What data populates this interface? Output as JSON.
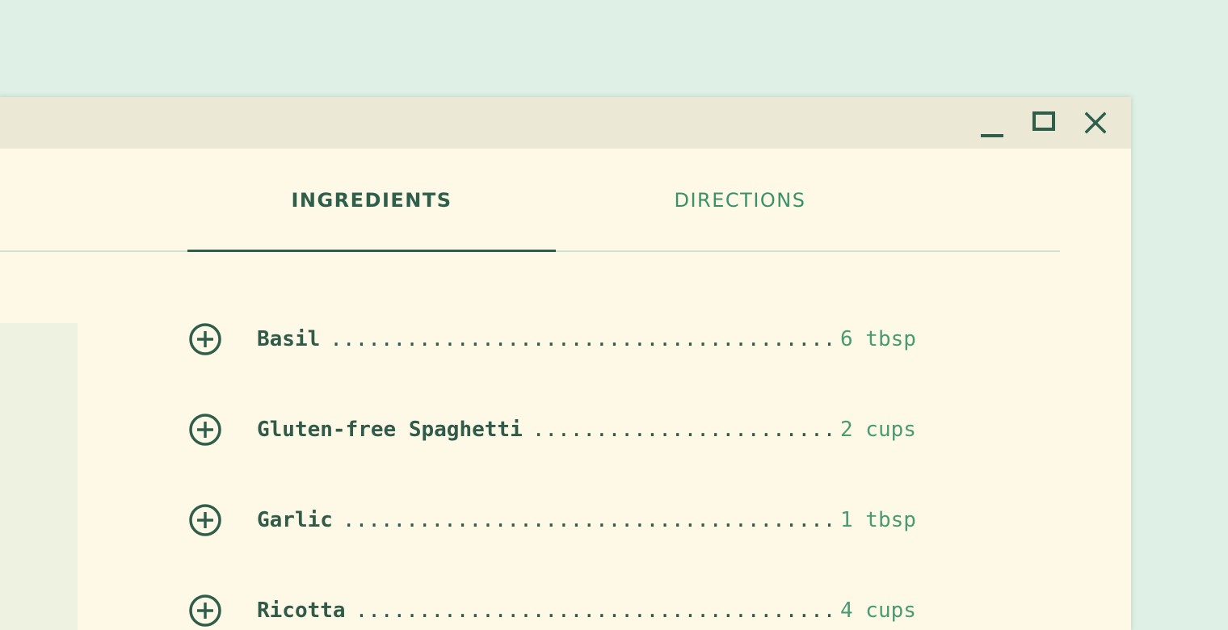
{
  "tabs": [
    {
      "label": "INGREDIENTS",
      "active": true
    },
    {
      "label": "DIRECTIONS",
      "active": false
    }
  ],
  "ingredients": [
    {
      "name": "Basil",
      "quantity": "6 tbsp"
    },
    {
      "name": "Gluten-free Spaghetti",
      "quantity": "2 cups"
    },
    {
      "name": "Garlic",
      "quantity": "1 tbsp"
    },
    {
      "name": "Ricotta",
      "quantity": "4 cups"
    }
  ],
  "icons": {
    "add": "plus-circle-icon",
    "minimize": "minimize-icon",
    "maximize": "maximize-icon",
    "close": "close-icon"
  },
  "colors": {
    "accent_dark": "#2f5e4b",
    "accent_light": "#3a9168",
    "background": "#dff1e6",
    "panel": "#fdf9e6",
    "titlebar": "#ebe9d6"
  }
}
